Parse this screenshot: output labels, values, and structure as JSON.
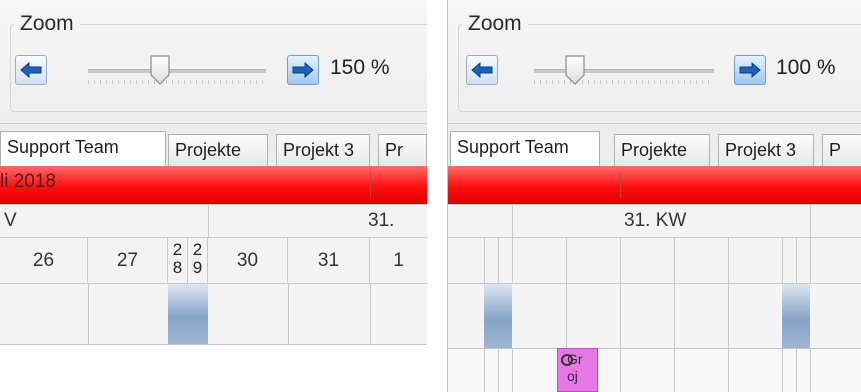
{
  "left": {
    "zoom": {
      "title": "Zoom",
      "value": "150 %",
      "level_percent": 150
    },
    "tabs": [
      "Support Team",
      "Projekte",
      "Projekt 3",
      "Pr"
    ],
    "month": "li 2018",
    "week_left": "V",
    "week_right": "31.",
    "days": [
      "26",
      "27",
      "2|8",
      "2|9",
      "30",
      "31",
      "1"
    ]
  },
  "right": {
    "zoom": {
      "title": "Zoom",
      "value": "100 %",
      "level_percent": 100
    },
    "tabs": [
      "Support Team",
      "Projekte",
      "Projekt 3",
      "P"
    ],
    "week": "31. KW",
    "task": {
      "label": "Gr\noj",
      "color": "#e678e6"
    }
  },
  "colors": {
    "red_bar": "#ff1a1a",
    "weekend": "#6f8fb8",
    "arrow": "#1c63b7"
  }
}
